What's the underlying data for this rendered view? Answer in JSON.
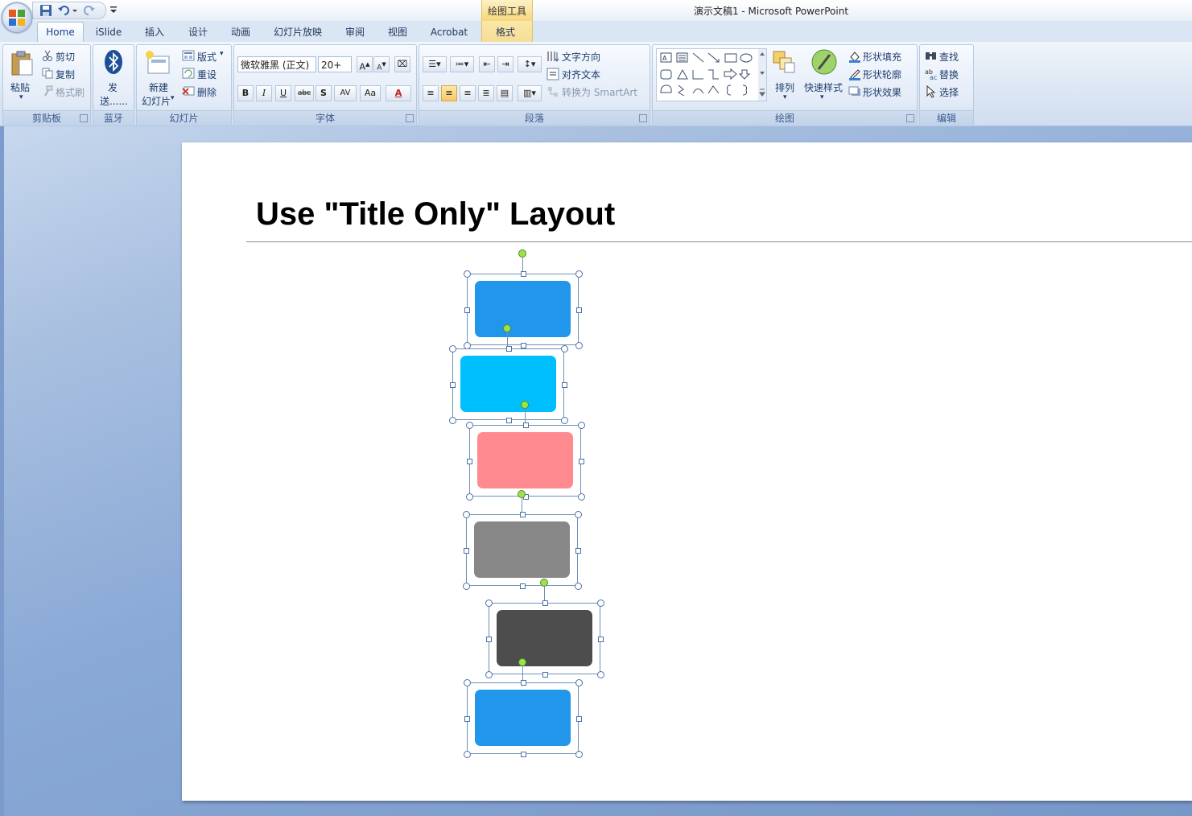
{
  "window": {
    "title": "演示文稿1 - Microsoft PowerPoint",
    "context_tool": "绘图工具"
  },
  "tabs": [
    "Home",
    "iSlide",
    "插入",
    "设计",
    "动画",
    "幻灯片放映",
    "审阅",
    "视图",
    "Acrobat",
    "格式"
  ],
  "ribbon": {
    "clipboard": {
      "label": "剪贴板",
      "paste": "粘贴",
      "cut": "剪切",
      "copy": "复制",
      "format_painter": "格式刷"
    },
    "bluetooth": {
      "label": "蓝牙",
      "send_1": "发",
      "send_2": "送......"
    },
    "slides": {
      "label": "幻灯片",
      "new_slide_1": "新建",
      "new_slide_2": "幻灯片",
      "layout": "版式",
      "reset": "重设",
      "delete": "删除"
    },
    "font": {
      "label": "字体",
      "font_name": "微软雅黑 (正文)",
      "font_size": "20+",
      "bold": "B",
      "italic": "I",
      "underline": "U",
      "strike": "abc",
      "shadow": "S",
      "spacing": "AV",
      "case": "Aa",
      "color": "A"
    },
    "paragraph": {
      "label": "段落",
      "text_direction": "文字方向",
      "align_text": "对齐文本",
      "smartart": "转换为 SmartArt"
    },
    "drawing": {
      "label": "绘图",
      "arrange": "排列",
      "quick_styles": "快速样式",
      "shape_fill": "形状填充",
      "shape_outline": "形状轮廓",
      "shape_effects": "形状效果"
    },
    "editing": {
      "label": "编辑",
      "find": "查找",
      "replace": "替换",
      "select": "选择"
    }
  },
  "slide": {
    "title": "Use \"Title Only\" Layout",
    "shapes": [
      {
        "name": "shape-blue-1",
        "color": "#2196eb"
      },
      {
        "name": "shape-cyan",
        "color": "#00bfff"
      },
      {
        "name": "shape-pink",
        "color": "#ff8a8f"
      },
      {
        "name": "shape-gray",
        "color": "#878787"
      },
      {
        "name": "shape-darkgray",
        "color": "#4d4d4d"
      },
      {
        "name": "shape-blue-2",
        "color": "#2196eb"
      }
    ]
  }
}
